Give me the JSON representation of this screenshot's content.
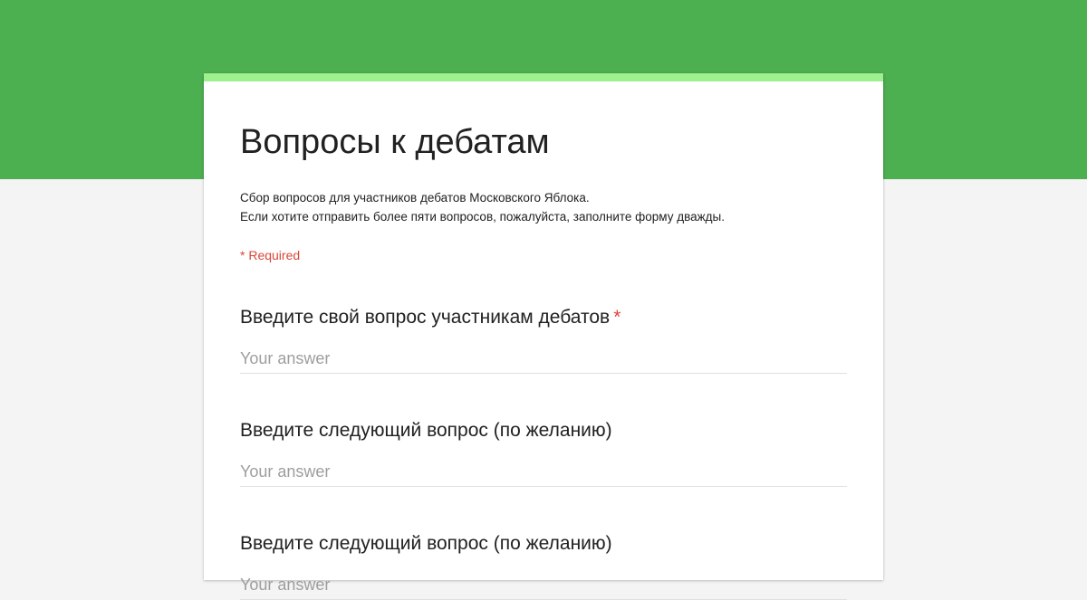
{
  "theme": {
    "header_color": "#4caf50",
    "accent_color": "#9ef08f",
    "background_color": "#f4f4f4",
    "required_color": "#db4437"
  },
  "form": {
    "title": "Вопросы к дебатам",
    "description_lines": [
      "Сбор вопросов для участников дебатов Московского Яблока.",
      "Если хотите отправить более пяти вопросов, пожалуйста, заполните форму дважды."
    ],
    "required_note": "* Required",
    "questions": [
      {
        "title": "Введите свой вопрос участникам дебатов",
        "required_mark": "*",
        "placeholder": "Your answer"
      },
      {
        "title": "Введите следующий вопрос (по желанию)",
        "required_mark": "",
        "placeholder": "Your answer"
      },
      {
        "title": "Введите следующий вопрос (по желанию)",
        "required_mark": "",
        "placeholder": "Your answer"
      }
    ]
  }
}
